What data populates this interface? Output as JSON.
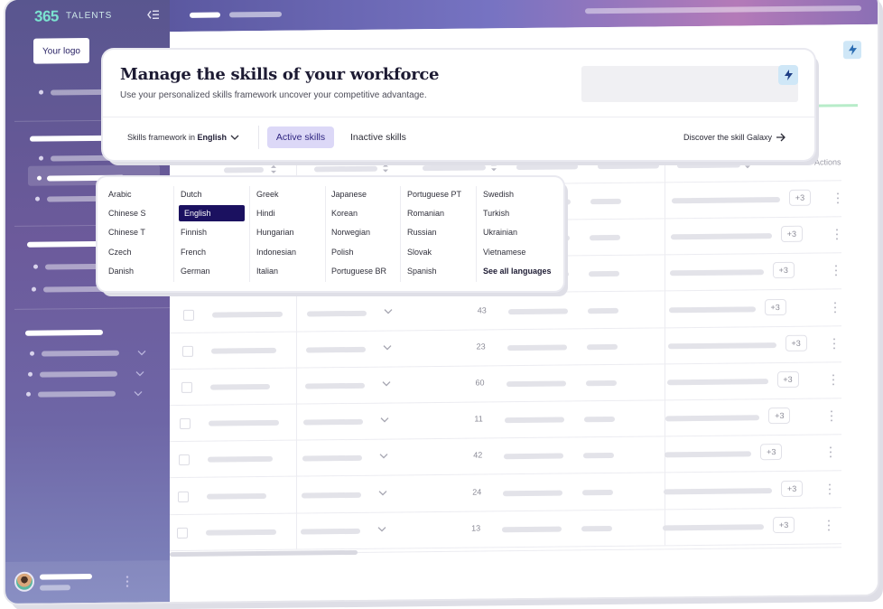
{
  "app": {
    "logo_mark": "365",
    "logo_text": "TALENTS",
    "your_logo_label": "Your logo"
  },
  "header": {
    "title": "Manage the skills of your workforce",
    "subtitle": "Use your personalized skills framework uncover your competitive advantage.",
    "framework_prefix": "Skills framework in",
    "framework_language": "English",
    "tabs": [
      {
        "label": "Active skills",
        "active": true
      },
      {
        "label": "Inactive skills",
        "active": false
      }
    ],
    "galaxy_link": "Discover the skill Galaxy"
  },
  "languages": {
    "columns": [
      [
        "Arabic",
        "Chinese S",
        "Chinese T",
        "Czech",
        "Danish"
      ],
      [
        "Dutch",
        "English",
        "Finnish",
        "French",
        "German"
      ],
      [
        "Greek",
        "Hindi",
        "Hungarian",
        "Indonesian",
        "Italian"
      ],
      [
        "Japanese",
        "Korean",
        "Norwegian",
        "Polish",
        "Portuguese BR"
      ],
      [
        "Portuguese PT",
        "Romanian",
        "Russian",
        "Slovak",
        "Spanish"
      ],
      [
        "Swedish",
        "Turkish",
        "Ukrainian",
        "Vietnamese",
        "See all languages"
      ]
    ],
    "selected": "English"
  },
  "table": {
    "actions_header": "Actions",
    "rows": [
      {
        "count": "",
        "extra": "+3"
      },
      {
        "count": "",
        "extra": "+3"
      },
      {
        "count": "",
        "extra": "+3"
      },
      {
        "count": "43",
        "extra": "+3"
      },
      {
        "count": "23",
        "extra": "+3"
      },
      {
        "count": "60",
        "extra": "+3"
      },
      {
        "count": "11",
        "extra": "+3"
      },
      {
        "count": "42",
        "extra": "+3"
      },
      {
        "count": "24",
        "extra": "+3"
      },
      {
        "count": "13",
        "extra": "+3"
      }
    ]
  },
  "icons": {
    "collapse": "collapse-sidebar-icon",
    "bolt": "lightning-bolt-icon",
    "chevron": "chevron-down-icon",
    "arrow": "arrow-right-icon",
    "sort": "sort-icon",
    "more": "more-vertical-icon"
  },
  "colors": {
    "sidebar_top": "#59568f",
    "sidebar_bottom": "#7f86be",
    "accent_dark": "#1b1160",
    "active_tab_bg": "#dcd8f7",
    "logo_teal": "#7be3d0"
  }
}
